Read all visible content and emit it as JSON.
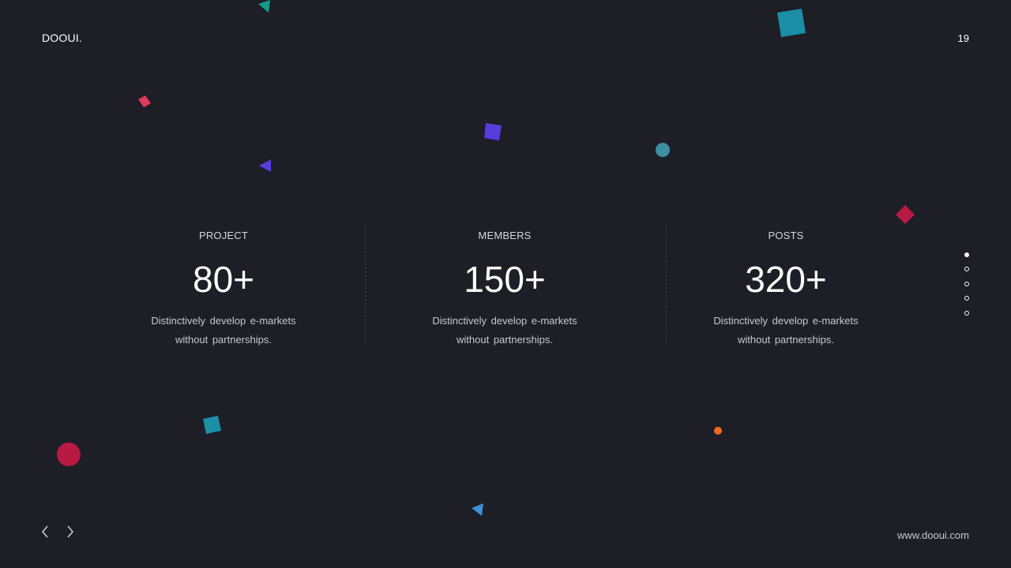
{
  "header": {
    "brand": "DOOUI.",
    "page_number": "19"
  },
  "stats": [
    {
      "label": "PROJECT",
      "value": "80+",
      "description_line1": "Distinctively develop  e-markets",
      "description_line2": "without partnerships."
    },
    {
      "label": "MEMBERS",
      "value": "150+",
      "description_line1": "Distinctively develop  e-markets",
      "description_line2": "without partnerships."
    },
    {
      "label": "POSTS",
      "value": "320+",
      "description_line1": "Distinctively develop  e-markets",
      "description_line2": "without partnerships."
    }
  ],
  "pagination": {
    "dot_count": 5,
    "active_index": 0
  },
  "navigation": {
    "prev_icon": "chevron-left-icon",
    "next_icon": "chevron-right-icon"
  },
  "footer": {
    "website": "www.dooui.com"
  },
  "colors": {
    "background": "#1d1e26",
    "teal": "#1a8fa6",
    "purple": "#5a3be0",
    "red": "#e23a5c",
    "crimson": "#b81a44",
    "blue": "#3b8fd4",
    "orange": "#f06a1f",
    "steel": "#3f8fa3"
  }
}
